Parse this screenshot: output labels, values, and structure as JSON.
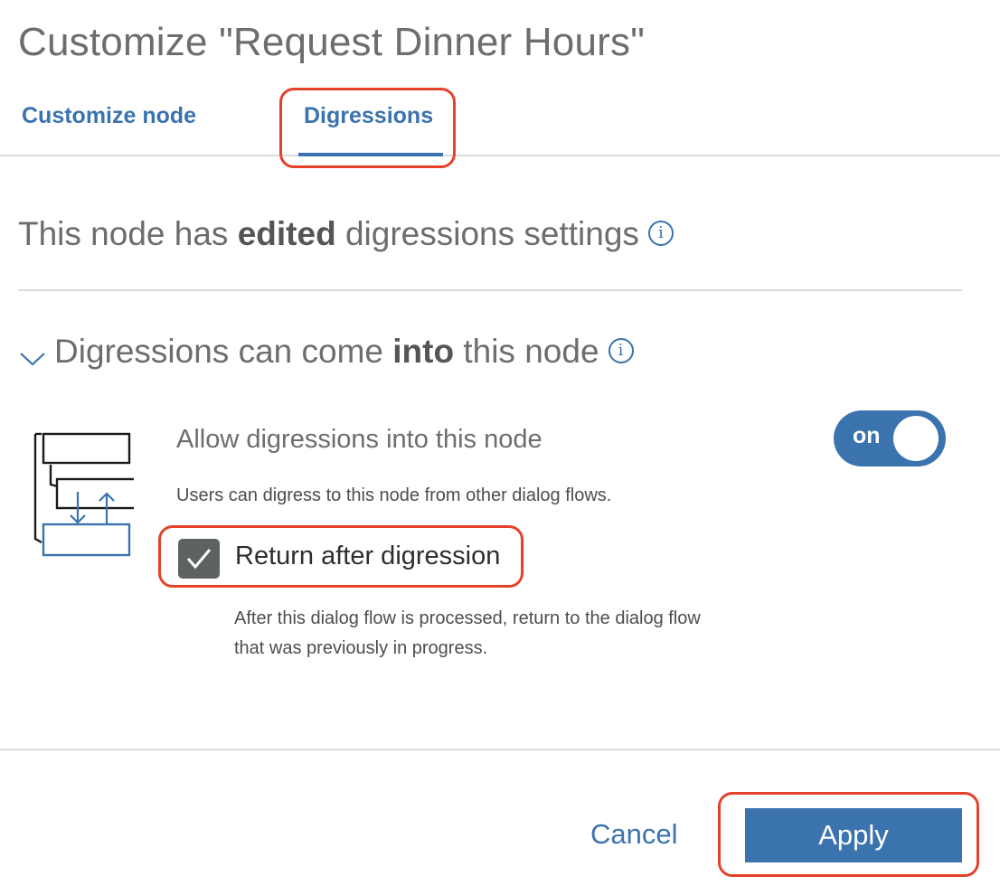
{
  "dialog": {
    "title": "Customize \"Request Dinner Hours\""
  },
  "tabs": [
    {
      "label": "Customize node",
      "active": false
    },
    {
      "label": "Digressions",
      "active": true
    }
  ],
  "summary": {
    "prefix": "This node has ",
    "emphasis": "edited",
    "suffix": " digressions settings",
    "info_icon": "info-icon"
  },
  "section": {
    "chevron_icon": "chevron-down-icon",
    "prefix": "Digressions can come ",
    "emphasis": "into",
    "suffix": " this node",
    "info_icon": "info-icon"
  },
  "allow": {
    "label": "Allow digressions into this node",
    "description": "Users can digress to this node from other dialog flows.",
    "toggle_label": "on",
    "toggle_state": true,
    "illustration_icon": "digression-flow-icon"
  },
  "return_option": {
    "label": "Return after digression",
    "checked": true,
    "description": "After this dialog flow is processed, return to the dialog flow that was previously in progress."
  },
  "footer": {
    "cancel_label": "Cancel",
    "apply_label": "Apply"
  },
  "colors": {
    "accent": "#3b73af",
    "highlight": "#e5422b",
    "checkbox": "#5d6363"
  }
}
